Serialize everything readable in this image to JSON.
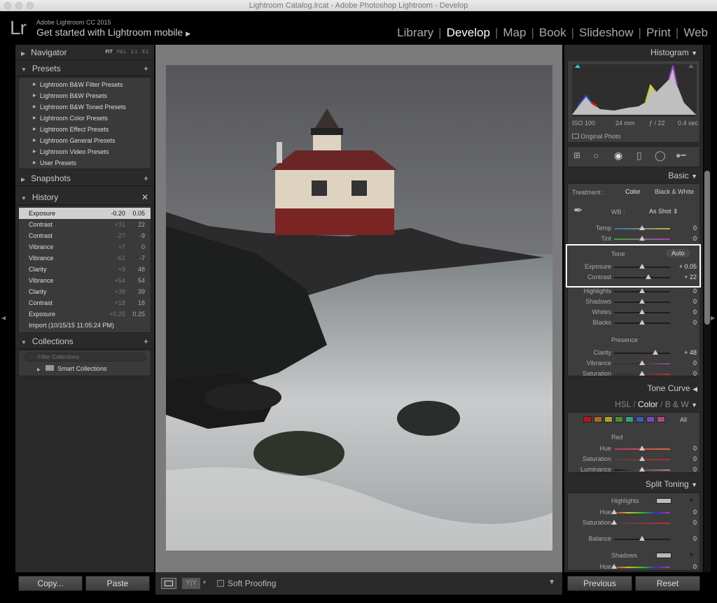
{
  "window": {
    "title": "Lightroom Catalog.lrcat - Adobe Photoshop Lightroom - Develop"
  },
  "identity": {
    "logo": "Lr",
    "app_name": "Adobe Lightroom CC 2015",
    "mobile_prompt": "Get started with Lightroom mobile"
  },
  "modules": [
    {
      "label": "Library"
    },
    {
      "label": "Develop",
      "active": true
    },
    {
      "label": "Map"
    },
    {
      "label": "Book"
    },
    {
      "label": "Slideshow"
    },
    {
      "label": "Print"
    },
    {
      "label": "Web"
    }
  ],
  "left": {
    "navigator": {
      "title": "Navigator",
      "zoom": [
        "FIT",
        "FILL",
        "1:1",
        "3:1"
      ]
    },
    "presets": {
      "title": "Presets",
      "items": [
        "Lightroom B&W Filter Presets",
        "Lightroom B&W Presets",
        "Lightroom B&W Toned Presets",
        "Lightroom Color Presets",
        "Lightroom Effect Presets",
        "Lightroom General Presets",
        "Lightroom Video Presets",
        "User Presets"
      ]
    },
    "snapshots": {
      "title": "Snapshots"
    },
    "history": {
      "title": "History",
      "items": [
        {
          "name": "Exposure",
          "change": "-0.20",
          "value": "0.05",
          "selected": true
        },
        {
          "name": "Contrast",
          "change": "+31",
          "value": "22"
        },
        {
          "name": "Contrast",
          "change": "-27",
          "value": "-9"
        },
        {
          "name": "Vibrance",
          "change": "+7",
          "value": "0"
        },
        {
          "name": "Vibrance",
          "change": "-61",
          "value": "-7"
        },
        {
          "name": "Clarity",
          "change": "+9",
          "value": "48"
        },
        {
          "name": "Vibrance",
          "change": "+54",
          "value": "54"
        },
        {
          "name": "Clarity",
          "change": "+39",
          "value": "39"
        },
        {
          "name": "Contrast",
          "change": "+18",
          "value": "18"
        },
        {
          "name": "Exposure",
          "change": "+0.25",
          "value": "0.25"
        },
        {
          "name": "Import (10/15/15 11:05:24 PM)",
          "change": "",
          "value": ""
        }
      ]
    },
    "collections": {
      "title": "Collections",
      "filter_placeholder": "Filter Collections",
      "items": [
        "Smart Collections"
      ]
    },
    "copy_label": "Copy...",
    "paste_label": "Paste"
  },
  "toolbar": {
    "soft_proofing": "Soft Proofing"
  },
  "right": {
    "histogram": {
      "title": "Histogram",
      "iso": "ISO 100",
      "focal": "24 mm",
      "aperture": "ƒ / 22",
      "shutter": "0.4 sec",
      "original_photo": "Original Photo"
    },
    "basic": {
      "title": "Basic",
      "treatment_label": "Treatment :",
      "color": "Color",
      "bw": "Black & White",
      "wb_label": "WB :",
      "wb_value": "As Shot",
      "tone_label": "Tone",
      "auto": "Auto",
      "presence_label": "Presence",
      "sliders": [
        {
          "label": "Temp",
          "value": "0",
          "pos": 0
        },
        {
          "label": "Tint",
          "value": "0",
          "pos": 0
        },
        {
          "label": "Exposure",
          "value": "+ 0.05",
          "pos": 0.01
        },
        {
          "label": "Contrast",
          "value": "+ 22",
          "pos": 0.22
        },
        {
          "label": "Highlights",
          "value": "0",
          "pos": 0
        },
        {
          "label": "Shadows",
          "value": "0",
          "pos": 0
        },
        {
          "label": "Whites",
          "value": "0",
          "pos": 0
        },
        {
          "label": "Blacks",
          "value": "0",
          "pos": 0
        },
        {
          "label": "Clarity",
          "value": "+ 48",
          "pos": 0.48
        },
        {
          "label": "Vibrance",
          "value": "0",
          "pos": 0
        },
        {
          "label": "Saturation",
          "value": "0",
          "pos": 0
        }
      ]
    },
    "tone_curve": {
      "title": "Tone Curve"
    },
    "hsl": {
      "hsl": "HSL",
      "color": "Color",
      "bw": "B & W",
      "all": "All",
      "swatches": [
        "#b01818",
        "#a8682a",
        "#a8a030",
        "#4a8a3a",
        "#3a9a8a",
        "#3a5ab0",
        "#7a4ab0",
        "#a84a7a"
      ],
      "selected": "Red",
      "sliders": [
        {
          "label": "Hue",
          "value": "0"
        },
        {
          "label": "Saturation",
          "value": "0"
        },
        {
          "label": "Luminance",
          "value": "0"
        }
      ]
    },
    "split": {
      "title": "Split Toning",
      "highlights": "Highlights",
      "shadows": "Shadows",
      "sliders": [
        {
          "label": "Hue",
          "value": "0"
        },
        {
          "label": "Saturation",
          "value": "0"
        },
        {
          "label": "Balance",
          "value": "0"
        },
        {
          "label": "Hue",
          "value": "0"
        }
      ]
    },
    "previous_label": "Previous",
    "reset_label": "Reset"
  }
}
